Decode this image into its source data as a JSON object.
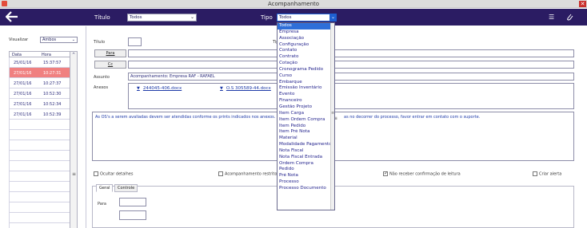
{
  "window": {
    "title": "Acompanhamento",
    "close_label": "✕"
  },
  "header": {
    "titulo_label": "Título",
    "titulo_value": "Todos",
    "tipo_label": "Tipo",
    "tipo_value": "Todos",
    "icons": [
      "back-arrow-icon",
      "filter-list-icon",
      "paperclip-icon"
    ],
    "bg_color": "#2b1c63"
  },
  "left": {
    "visualizar_label": "Visualizar",
    "visualizar_value": "Ambos",
    "columns": [
      "Data",
      "Hora"
    ],
    "rows": [
      {
        "date": "25/01/16",
        "time": "15:37:57",
        "selected": false
      },
      {
        "date": "27/01/16",
        "time": "10:27:31",
        "selected": true
      },
      {
        "date": "27/01/16",
        "time": "10:27:37",
        "selected": false
      },
      {
        "date": "27/01/16",
        "time": "10:52:30",
        "selected": false
      },
      {
        "date": "27/01/16",
        "time": "10:52:34",
        "selected": false
      },
      {
        "date": "27/01/16",
        "time": "10:52:39",
        "selected": false
      }
    ],
    "selected_color": "#f08080"
  },
  "form": {
    "titulo_label": "Título",
    "tipo_label": "Tipo",
    "para_button": "Para",
    "cc_button": "Cc",
    "assunto_label": "Assunto",
    "assunto_value": "Acompanhamento: Empresa RAF - RAFAEL",
    "anexos_label": "Anexos",
    "attachments": [
      "244045-406.docx",
      "O.S 305589-44.docx"
    ],
    "body_text_left": "As OS's a serem avaliadas devem ser atendidas conforme os prints indicados nos anexos.",
    "body_text_right": "as no decorrer do processo, favor entrar em contato com o suporte.",
    "ocultar_detalhes": "Ocultar detalhes",
    "acompanhamento_restrito": "Acompanhamento restrito",
    "nao_receber": "Não receber confirmação de leitura",
    "criar_alerta": "Criar alerta",
    "tabs": [
      "Geral",
      "Controle"
    ],
    "para_label": "Para"
  },
  "dropdown": {
    "items": [
      "Todos",
      "Empresa",
      "Associação",
      "Configuração",
      "Contato",
      "Contrato",
      "Cotação",
      "Cronograma Pedido",
      "Curso",
      "Embarque",
      "Emissão Inventário",
      "Evento",
      "Financeiro",
      "Gestão Projeto",
      "Item Carga",
      "Item Ordem Compra",
      "Item Pedido",
      "Item Pré Nota",
      "Material",
      "Modalidade Pagamento",
      "Nota Fiscal",
      "Nota Fiscal Entrada",
      "Ordem Compra",
      "Pedido",
      "Pré Nota",
      "Processo",
      "Processo Documento"
    ],
    "selected_index": 0,
    "highlight_color": "#2e6fd8"
  }
}
